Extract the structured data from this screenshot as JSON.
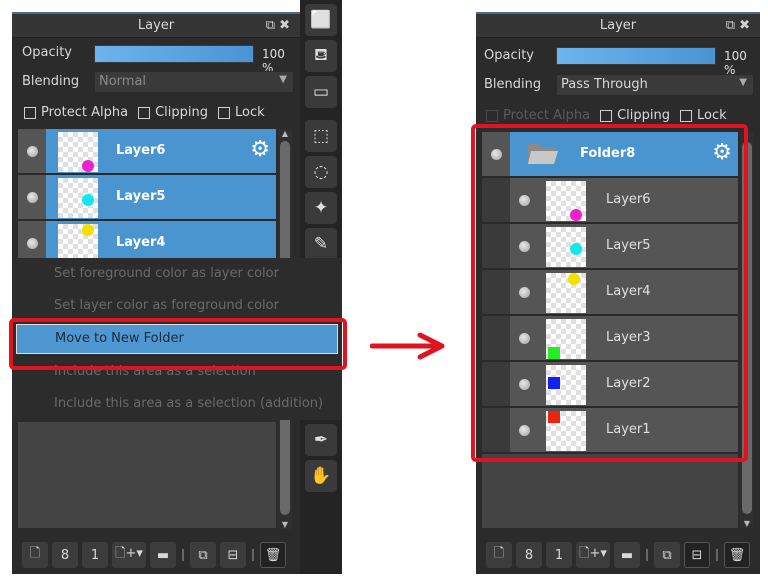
{
  "before": {
    "panel_title": "Layer",
    "title_icons": "☐ ✖",
    "opacity_label": "Opacity",
    "opacity_value": "100 %",
    "opacity_fraction": 1.0,
    "blending_label": "Blending",
    "blending_value": "Normal",
    "checkboxes": [
      {
        "label": "Protect Alpha",
        "checked": false
      },
      {
        "label": "Clipping",
        "checked": false
      },
      {
        "label": "Lock",
        "checked": false
      }
    ],
    "layers": [
      {
        "name": "Layer6",
        "mark_color": "#ee22cc",
        "mark_shape": "circle",
        "selected": true,
        "gear": true
      },
      {
        "name": "Layer5",
        "mark_color": "#11e8ee",
        "mark_shape": "circle",
        "selected": true
      },
      {
        "name": "Layer4",
        "mark_color": "#f2e000",
        "mark_shape": "circle",
        "selected": true
      }
    ],
    "context_menu": [
      {
        "label": "Set foreground color as layer color",
        "enabled": false
      },
      {
        "label": "Set layer color as foreground color",
        "enabled": false
      },
      {
        "label": "Move to New Folder",
        "highlighted": true
      },
      {
        "label": "Include this area as a selection",
        "enabled": false
      },
      {
        "label": "Include this area as a selection (addition)",
        "enabled": false
      }
    ]
  },
  "after": {
    "panel_title": "Layer",
    "title_icons": "☐ ✖",
    "opacity_label": "Opacity",
    "opacity_value": "100 %",
    "opacity_fraction": 1.0,
    "blending_label": "Blending",
    "blending_value": "Pass Through",
    "checkboxes": [
      {
        "label": "Protect Alpha",
        "checked": false,
        "disabled": true
      },
      {
        "label": "Clipping",
        "checked": false
      },
      {
        "label": "Lock",
        "checked": false
      }
    ],
    "folder": {
      "name": "Folder8",
      "selected": true,
      "gear": true
    },
    "layers": [
      {
        "name": "Layer6",
        "mark_color": "#ee22cc",
        "mark_shape": "circle"
      },
      {
        "name": "Layer5",
        "mark_color": "#11e8ee",
        "mark_shape": "circle"
      },
      {
        "name": "Layer4",
        "mark_color": "#f2e000",
        "mark_shape": "circle"
      },
      {
        "name": "Layer3",
        "mark_color": "#22ee22",
        "mark_shape": "square"
      },
      {
        "name": "Layer2",
        "mark_color": "#1122ee",
        "mark_shape": "square"
      },
      {
        "name": "Layer1",
        "mark_color": "#ee2211",
        "mark_shape": "square"
      }
    ]
  },
  "bottom_toolbar": [
    "new-raster-layer",
    "new-vector-layer",
    "new-1bit-layer",
    "new-layer-menu",
    "new-folder",
    "duplicate-layer",
    "merge-layer",
    "delete-layer"
  ],
  "side_tools": [
    "color-box",
    "fill-bucket",
    "gradient",
    "rect-select",
    "lasso-select",
    "magic-wand",
    "select-pen",
    "eyedropper",
    "hand"
  ],
  "colors": {
    "accent": "#4a94d0",
    "highlight_box": "#e0141e",
    "panel_bg": "#2b2b2b"
  }
}
